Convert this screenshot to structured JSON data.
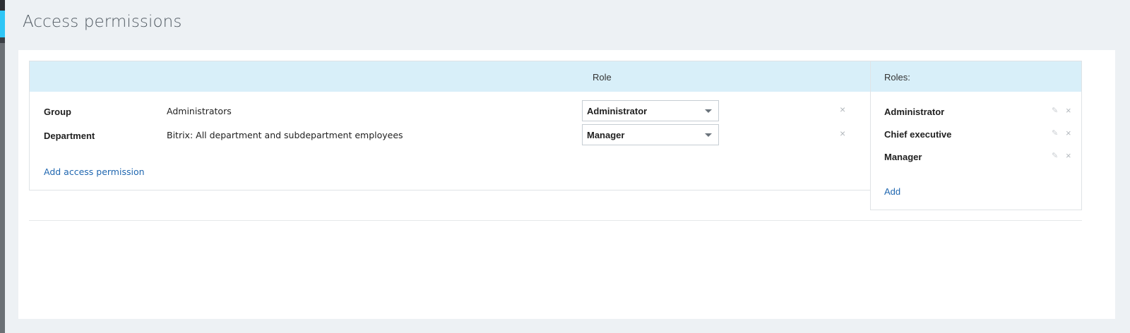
{
  "page": {
    "title": "Access permissions"
  },
  "permissions": {
    "role_column_title": "Role",
    "rows": [
      {
        "type": "Group",
        "entity": "Administrators",
        "role": "Administrator",
        "remove_icon": "×"
      },
      {
        "type": "Department",
        "entity": "Bitrix: All department and subdepartment employees",
        "role": "Manager",
        "remove_icon": "×"
      }
    ],
    "add_label": "Add access permission"
  },
  "roles": {
    "title": "Roles:",
    "items": [
      {
        "name": "Administrator",
        "edit_icon": "✎",
        "delete_icon": "×"
      },
      {
        "name": "Chief executive",
        "edit_icon": "✎",
        "delete_icon": "×"
      },
      {
        "name": "Manager",
        "edit_icon": "✎",
        "delete_icon": "×"
      }
    ],
    "add_label": "Add"
  },
  "colors": {
    "header_background": "#d8eff9",
    "link": "#2067b0",
    "page_background": "#edf1f4",
    "sidebar_accent": "#2fc6f6"
  }
}
